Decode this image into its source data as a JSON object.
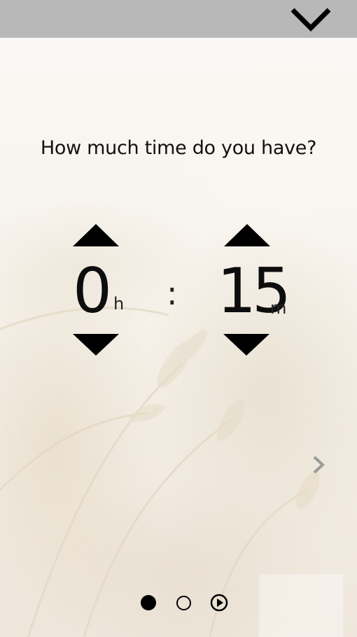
{
  "question": "How much time do you have?",
  "hours": {
    "value": "0",
    "unit": "h"
  },
  "separator": ":",
  "minutes": {
    "value": "15",
    "unit": "m"
  },
  "icons": {
    "collapse": "chevron-down-icon",
    "increment": "triangle-up-icon",
    "decrement": "triangle-down-icon",
    "next": "chevron-right-icon",
    "play": "play-circle-icon"
  },
  "pager": {
    "pages": 3,
    "current": 1
  },
  "colors": {
    "topbar": "#b8b8b8",
    "text": "#111111",
    "next_arrow": "#9a9a9a"
  }
}
